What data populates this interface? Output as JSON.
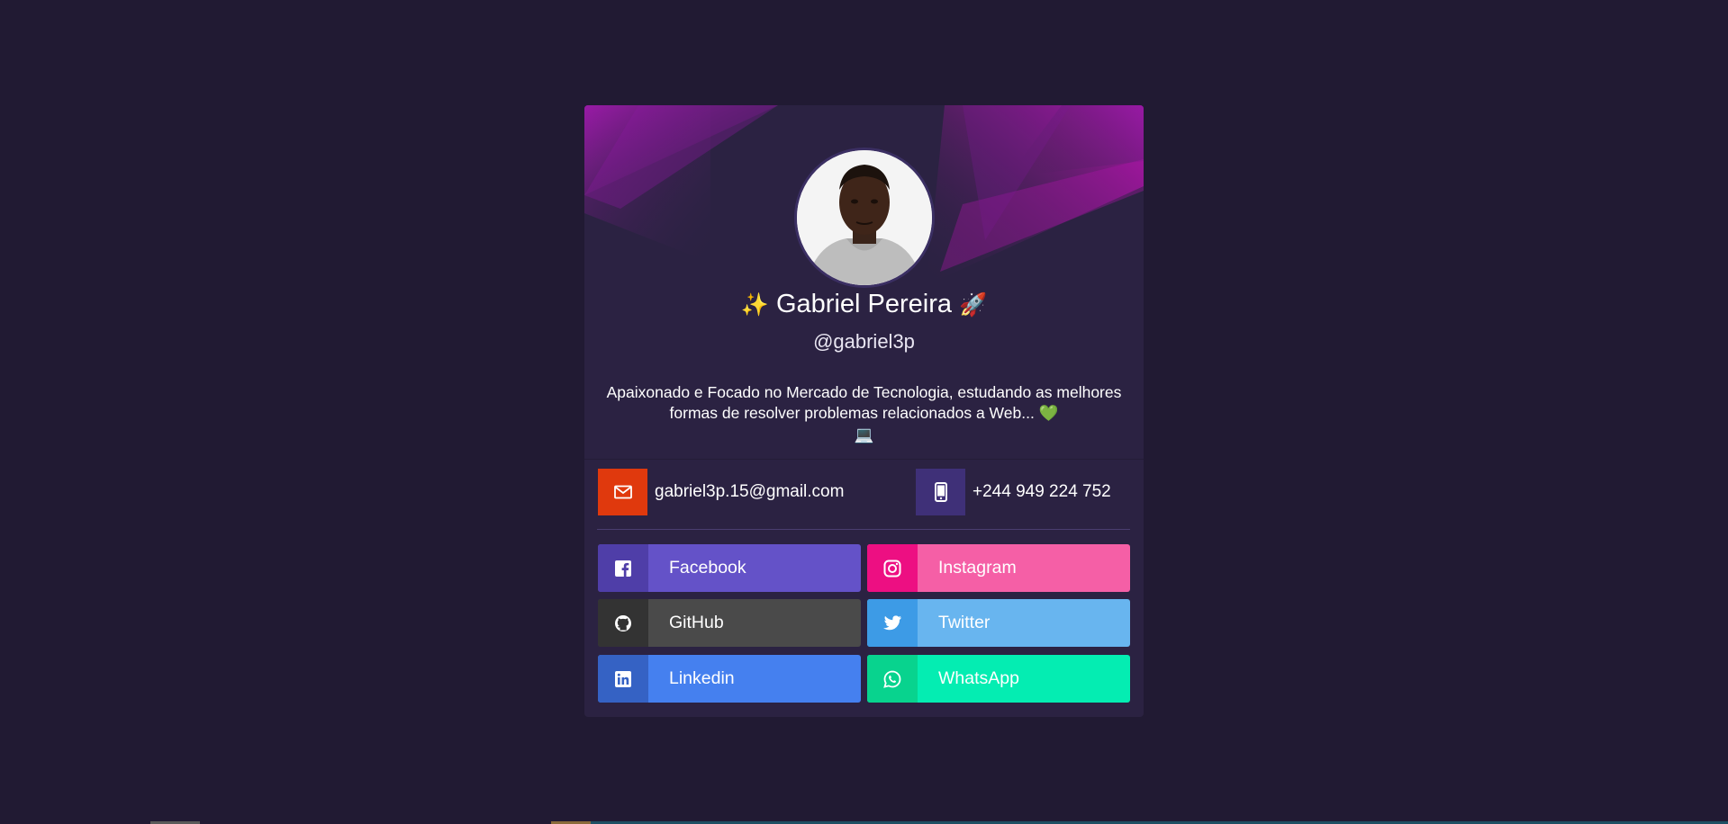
{
  "profile": {
    "name_prefix_emoji": "✨",
    "name": "Gabriel Pereira",
    "name_suffix_emoji": "🚀",
    "handle": "@gabriel3p",
    "bio_text": "Apaixonado e Focado no Mercado de Tecnologia, estudando as melhores formas de resolver problemas relacionados a Web...",
    "bio_emoji_1": "💚",
    "bio_emoji_2": "💻"
  },
  "contacts": {
    "email": "gabriel3p.15@gmail.com",
    "phone": "+244 949 224 752"
  },
  "social": [
    {
      "label": "Facebook",
      "icon": "facebook-icon"
    },
    {
      "label": "Instagram",
      "icon": "instagram-icon"
    },
    {
      "label": "GitHub",
      "icon": "github-icon"
    },
    {
      "label": "Twitter",
      "icon": "twitter-icon"
    },
    {
      "label": "Linkedin",
      "icon": "linkedin-icon"
    },
    {
      "label": "WhatsApp",
      "icon": "whatsapp-icon"
    }
  ],
  "colors": {
    "background": "#211a33",
    "card": "#2b2242",
    "email_icon_bg": "#e0390d",
    "phone_icon_bg": "#3f3078",
    "facebook": "#6452c8",
    "instagram": "#f55fa6",
    "github": "#4a4a4a",
    "twitter": "#68b5ef",
    "linkedin": "#4580ef",
    "whatsapp": "#04edb2"
  }
}
